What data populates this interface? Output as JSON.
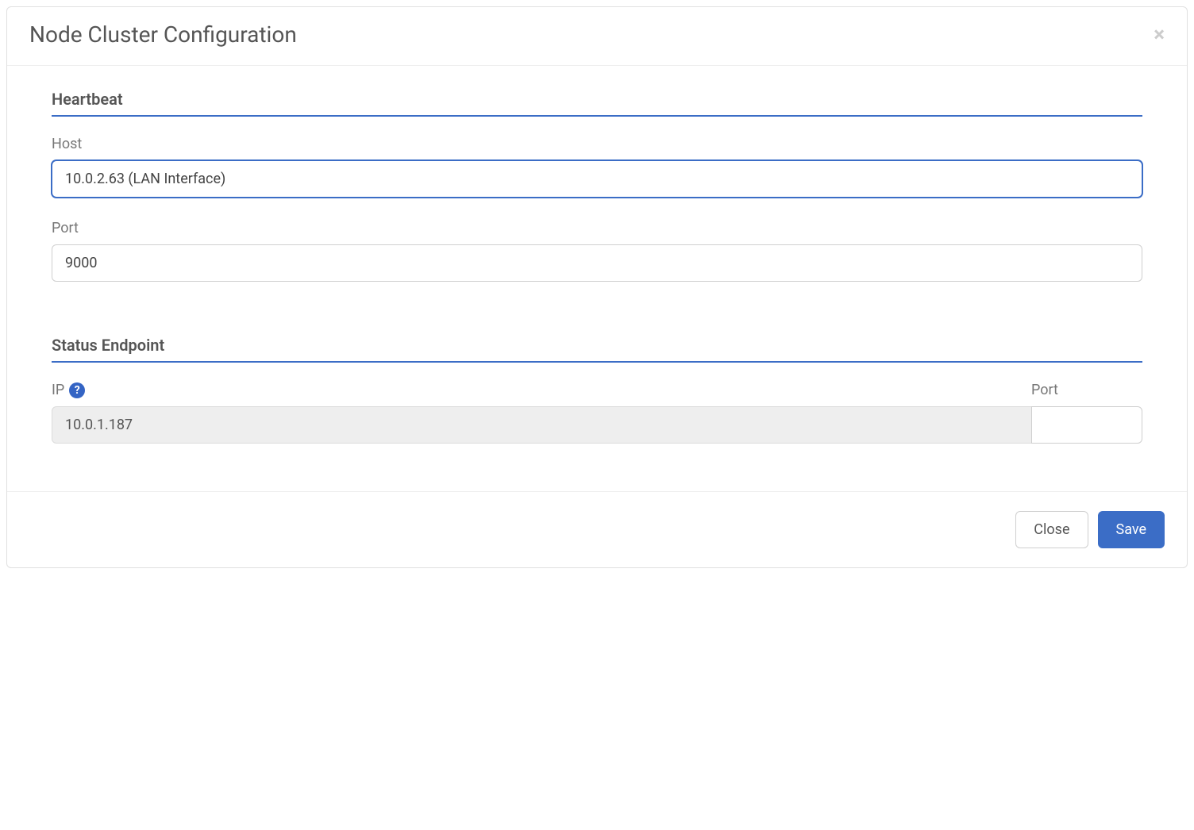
{
  "modal": {
    "title": "Node Cluster Configuration"
  },
  "heartbeat": {
    "section_title": "Heartbeat",
    "host_label": "Host",
    "host_value": "10.0.2.63 (LAN Interface)",
    "port_label": "Port",
    "port_value": "9000"
  },
  "status_endpoint": {
    "section_title": "Status Endpoint",
    "ip_label": "IP",
    "ip_value": "10.0.1.187",
    "port_label": "Port",
    "port_value": ""
  },
  "footer": {
    "close_label": "Close",
    "save_label": "Save"
  },
  "icons": {
    "help": "?"
  }
}
